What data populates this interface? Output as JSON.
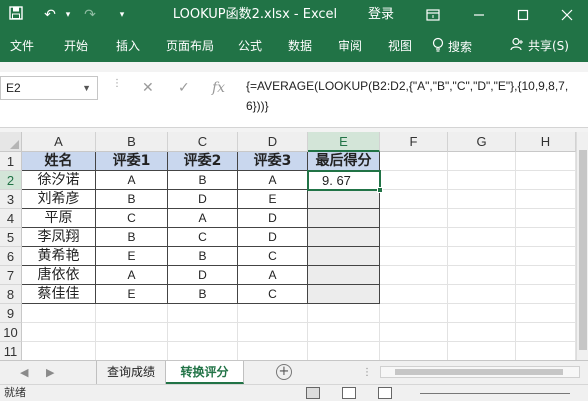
{
  "window": {
    "title": "LOOKUP函数2.xlsx  -  Excel",
    "login": "登录",
    "save_icon": "save-icon",
    "undo_glyph": "↶",
    "redo_glyph": "↷",
    "customize_glyph": "▾"
  },
  "ribbon": {
    "tabs": [
      "文件",
      "开始",
      "插入",
      "页面布局",
      "公式",
      "数据",
      "审阅",
      "视图"
    ],
    "search_label": "搜索",
    "share_label": "共享(S)"
  },
  "formula_bar": {
    "name_box": "E2",
    "cancel_glyph": "✕",
    "enter_glyph": "✓",
    "fx_glyph": "fx",
    "formula": "{=AVERAGE(LOOKUP(B2:D2,{\"A\",\"B\",\"C\",\"D\",\"E\"},{10,9,8,7,6}))}"
  },
  "grid": {
    "columns": [
      "A",
      "B",
      "C",
      "D",
      "E",
      "F",
      "G",
      "H"
    ],
    "rows": [
      "1",
      "2",
      "3",
      "4",
      "5",
      "6",
      "7",
      "8",
      "9",
      "10",
      "11"
    ],
    "selected_cell": "E2",
    "header_row": [
      "姓名",
      "评委1",
      "评委2",
      "评委3",
      "最后得分"
    ],
    "records": [
      {
        "name": "徐汐诺",
        "j1": "A",
        "j2": "B",
        "j3": "A",
        "score": "9. 67"
      },
      {
        "name": "刘希彦",
        "j1": "B",
        "j2": "D",
        "j3": "E",
        "score": ""
      },
      {
        "name": "平原",
        "j1": "C",
        "j2": "A",
        "j3": "D",
        "score": ""
      },
      {
        "name": "李凤翔",
        "j1": "B",
        "j2": "C",
        "j3": "D",
        "score": ""
      },
      {
        "name": "黄希艳",
        "j1": "E",
        "j2": "B",
        "j3": "C",
        "score": ""
      },
      {
        "name": "唐依依",
        "j1": "A",
        "j2": "D",
        "j3": "A",
        "score": ""
      },
      {
        "name": "蔡佳佳",
        "j1": "E",
        "j2": "B",
        "j3": "C",
        "score": ""
      }
    ],
    "header_fill": "#c9d7ee",
    "selection_color": "#217346"
  },
  "sheets": {
    "tabs": [
      "查询成绩",
      "转换评分"
    ],
    "active": "转换评分",
    "add_glyph": "+",
    "prev_glyph": "◀",
    "next_glyph": "▶"
  },
  "status": {
    "ready": "就绪"
  },
  "colors": {
    "accent": "#217346"
  }
}
